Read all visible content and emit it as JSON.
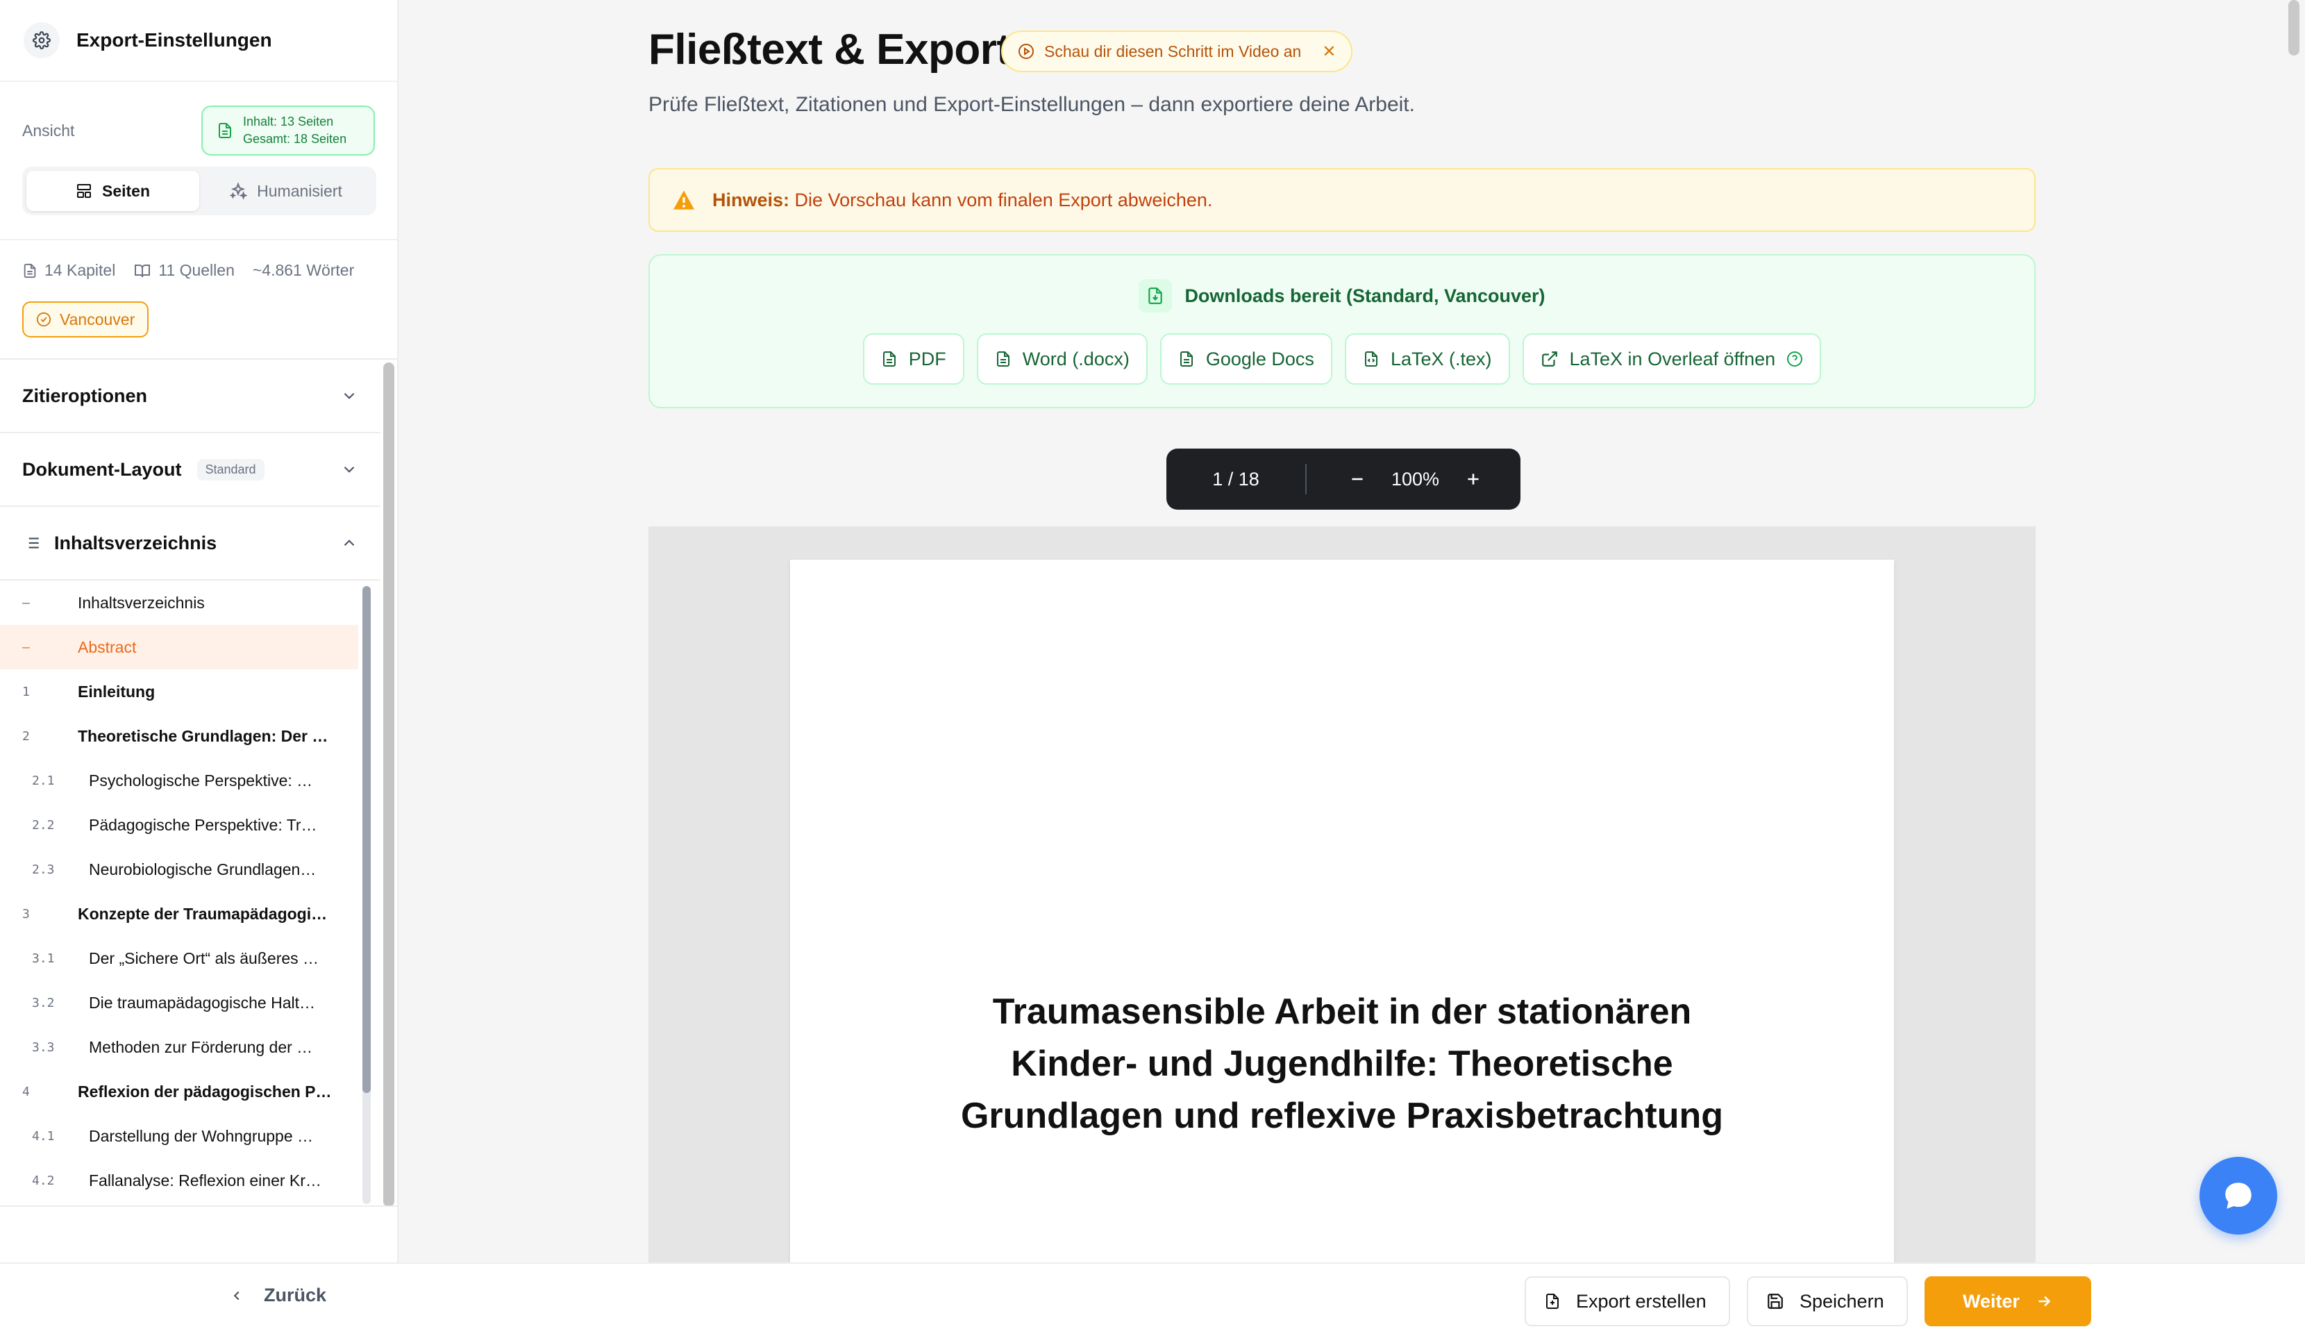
{
  "sidebar": {
    "title": "Export-Einstellungen",
    "view_label": "Ansicht",
    "pages_content": "Inhalt: 13 Seiten",
    "pages_total": "Gesamt: 18 Seiten",
    "seg_pages": "Seiten",
    "seg_humanized": "Humanisiert",
    "stats": {
      "chapters": "14 Kapitel",
      "sources": "11 Quellen",
      "words": "~4.861 Wörter"
    },
    "citation_style": "Vancouver",
    "sections": [
      {
        "title": "Zitieroptionen"
      },
      {
        "title": "Dokument-Layout",
        "badge": "Standard"
      },
      {
        "title": "Inhaltsverzeichnis"
      }
    ],
    "toc": [
      {
        "num": "—",
        "label": "Inhaltsverzeichnis",
        "level": 0,
        "bold": false
      },
      {
        "num": "—",
        "label": "Abstract",
        "level": 0,
        "bold": false,
        "active": true
      },
      {
        "num": "1",
        "label": "Einleitung",
        "level": 0,
        "bold": true
      },
      {
        "num": "2",
        "label": "Theoretische Grundlagen: Der …",
        "level": 0,
        "bold": true
      },
      {
        "num": "2.1",
        "label": "Psychologische Perspektive: …",
        "level": 1
      },
      {
        "num": "2.2",
        "label": "Pädagogische Perspektive: Tr…",
        "level": 1
      },
      {
        "num": "2.3",
        "label": "Neurobiologische Grundlagen…",
        "level": 1
      },
      {
        "num": "3",
        "label": "Konzepte der Traumapädagogi…",
        "level": 0,
        "bold": true
      },
      {
        "num": "3.1",
        "label": "Der „Sichere Ort“ als äußeres …",
        "level": 1
      },
      {
        "num": "3.2",
        "label": "Die traumapädagogische Halt…",
        "level": 1
      },
      {
        "num": "3.3",
        "label": "Methoden zur Förderung der …",
        "level": 1
      },
      {
        "num": "4",
        "label": "Reflexion der pädagogischen P…",
        "level": 0,
        "bold": true
      },
      {
        "num": "4.1",
        "label": "Darstellung der Wohngruppe …",
        "level": 1
      },
      {
        "num": "4.2",
        "label": "Fallanalyse: Reflexion einer Kr…",
        "level": 1
      }
    ]
  },
  "main": {
    "title": "Fließtext & Export",
    "video_chip": "Schau dir diesen Schritt im Video an",
    "subtitle": "Prüfe Fließtext, Zitationen und Export-Einstellungen – dann exportiere deine Arbeit.",
    "hint_label": "Hinweis:",
    "hint_text": "Die Vorschau kann vom finalen Export abweichen.",
    "downloads_title": "Downloads bereit (Standard, Vancouver)",
    "downloads": [
      "PDF",
      "Word (.docx)",
      "Google Docs",
      "LaTeX (.tex)",
      "LaTeX in Overleaf öffnen"
    ],
    "page_indicator": "1 / 18",
    "zoom": "100%",
    "doc_title": "Traumasensible Arbeit in der stationären Kinder- und Jugendhilfe: Theoretische Grundlagen und reflexive Praxisbetrachtung"
  },
  "footer": {
    "back": "Zurück",
    "export": "Export erstellen",
    "save": "Speichern",
    "next": "Weiter"
  },
  "colors": {
    "accent": "#f59e0b",
    "success": "#166534",
    "active_toc": "#ea6a1a",
    "chat": "#3b82f6"
  }
}
